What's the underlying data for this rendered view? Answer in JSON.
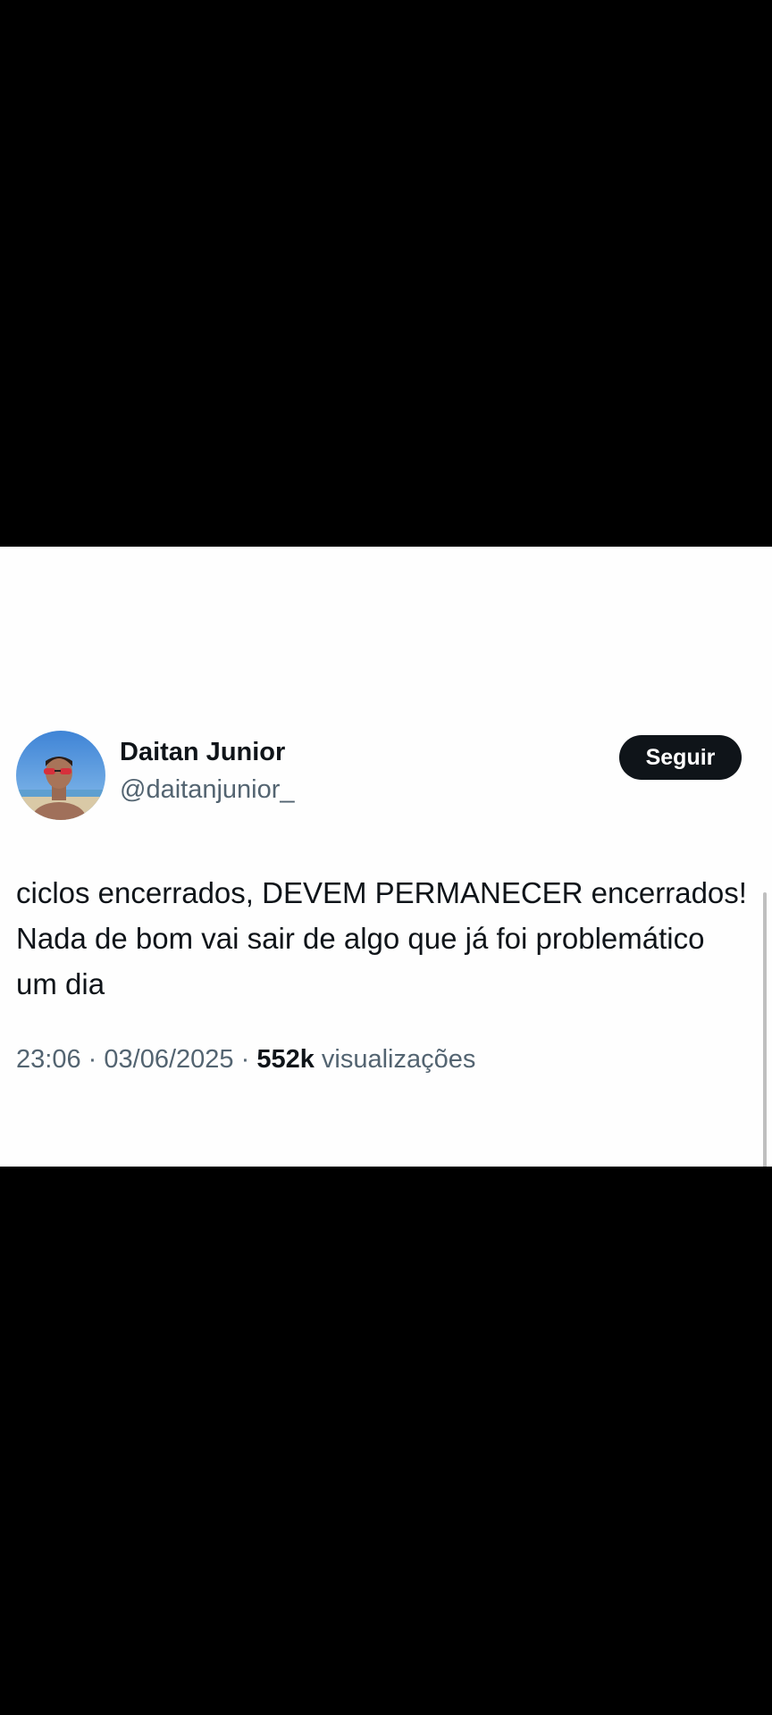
{
  "tweet": {
    "author": {
      "display_name": "Daitan Junior",
      "handle": "@daitanjunior_"
    },
    "follow_label": "Seguir",
    "text": "ciclos encerrados, DEVEM PERMANECER encerrados! Nada de bom vai sair de algo que já foi problemático um dia",
    "time": "23:06",
    "date": "03/06/2025",
    "separator": "·",
    "views_count": "552k",
    "views_label": "visualizações"
  },
  "colors": {
    "background_band": "#000000",
    "card_background": "#fefefe",
    "primary_text": "#0f1419",
    "secondary_text": "#536471",
    "button_background": "#0f1419",
    "button_text": "#ffffff"
  },
  "icons": {
    "avatar": "profile-photo"
  }
}
